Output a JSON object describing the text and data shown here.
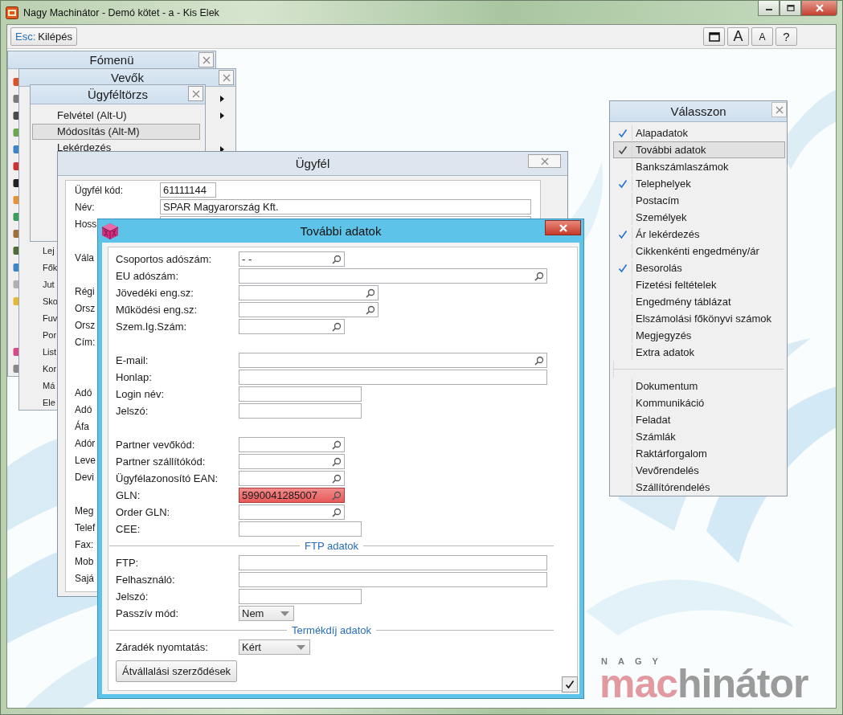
{
  "app": {
    "title": "Nagy Machinátor - Demó kötet - a - Kis Elek"
  },
  "toolbar": {
    "exit": {
      "key": "Esc:",
      "label": "Kilépés"
    },
    "tools": [
      {
        "kind": "window"
      },
      {
        "kind": "font-up",
        "label": "A"
      },
      {
        "kind": "font-down",
        "label": "A"
      },
      {
        "kind": "help",
        "label": "?"
      }
    ]
  },
  "main_menu": {
    "title": "Fómenü"
  },
  "customers_menu": {
    "title": "Vevők",
    "rows": [
      {
        "submenu": true
      },
      {
        "submenu": true
      },
      {
        "submenu": false
      },
      {
        "submenu": true
      }
    ],
    "items": [
      "Lej",
      "Fők",
      "Jut",
      "Sko",
      "Fuv",
      "Por",
      "List",
      "Kor",
      "Má",
      "Ele"
    ]
  },
  "client_menu": {
    "title": "Ügyféltörzs",
    "items": [
      {
        "label": "Felvétel (Alt-U)",
        "selected": false
      },
      {
        "label": "Módosítás (Alt-M)",
        "selected": true
      },
      {
        "label": "Lekérdezés",
        "selected": false
      }
    ]
  },
  "client_window": {
    "title": "Ügyfél",
    "rows": [
      {
        "kind": "short-field",
        "label": "Ügyfél kód:",
        "value": "61111144"
      },
      {
        "kind": "long-field",
        "label": "Név:",
        "value": "SPAR Magyarország Kft."
      },
      {
        "kind": "long-field",
        "label": "Hoss"
      },
      {
        "kind": "gap"
      },
      {
        "kind": "label",
        "label": "Vála"
      },
      {
        "kind": "gap"
      },
      {
        "kind": "label",
        "label": "Régi"
      },
      {
        "kind": "label",
        "label": "Orsz"
      },
      {
        "kind": "label",
        "label": "Orsz"
      },
      {
        "kind": "label",
        "label": "Cím:"
      },
      {
        "kind": "gap"
      },
      {
        "kind": "gap"
      },
      {
        "kind": "label",
        "label": "Adó"
      },
      {
        "kind": "label",
        "label": "Adó"
      },
      {
        "kind": "label",
        "label": "Áfa"
      },
      {
        "kind": "label",
        "label": "Adór"
      },
      {
        "kind": "label",
        "label": "Leve"
      },
      {
        "kind": "label",
        "label": "Devi"
      },
      {
        "kind": "gap"
      },
      {
        "kind": "label",
        "label": "Meg"
      },
      {
        "kind": "label",
        "label": "Telef"
      },
      {
        "kind": "label",
        "label": "Fax:"
      },
      {
        "kind": "label",
        "label": "Mob"
      },
      {
        "kind": "label",
        "label": "Sajá"
      }
    ]
  },
  "dialog": {
    "title": "További adatok",
    "rows": [
      {
        "kind": "tiny-field",
        "label": "Csoportos adószám:",
        "value": "- -",
        "search": true,
        "invalid": false
      },
      {
        "kind": "long-field",
        "label": "EU adószám:",
        "search": true,
        "invalid": false
      },
      {
        "kind": "mid-field",
        "label": "Jövedéki eng.sz:",
        "search": true,
        "invalid": false
      },
      {
        "kind": "mid-field",
        "label": "Működési eng.sz:",
        "search": true,
        "invalid": false
      },
      {
        "kind": "tiny-field",
        "label": "Szem.Ig.Szám:",
        "search": true,
        "invalid": false
      },
      {
        "kind": "gap"
      },
      {
        "kind": "long-field",
        "label": "E-mail:",
        "search": true,
        "invalid": false
      },
      {
        "kind": "long-field",
        "label": "Honlap:",
        "search": false,
        "invalid": false
      },
      {
        "kind": "short-field",
        "label": "Login név:",
        "search": false,
        "invalid": false
      },
      {
        "kind": "short-field",
        "label": "Jelszó:",
        "search": false,
        "invalid": false
      },
      {
        "kind": "gap"
      },
      {
        "kind": "tiny-field",
        "label": "Partner vevőkód:",
        "search": true,
        "invalid": false
      },
      {
        "kind": "tiny-field",
        "label": "Partner szállítókód:",
        "search": true,
        "invalid": false
      },
      {
        "kind": "tiny-field",
        "label": "Ügyfélazonosító EAN:",
        "search": true,
        "invalid": false
      },
      {
        "kind": "tiny-field",
        "label": "GLN:",
        "value": "5990041285007",
        "search": true,
        "invalid": true
      },
      {
        "kind": "tiny-field",
        "label": "Order GLN:",
        "search": true,
        "invalid": false
      },
      {
        "kind": "short-field",
        "label": "CEE:",
        "search": false,
        "invalid": false
      },
      {
        "kind": "separator",
        "label": "FTP adatok"
      },
      {
        "kind": "long-field",
        "label": "FTP:",
        "search": false,
        "invalid": false
      },
      {
        "kind": "long-field",
        "label": "Felhasználó:",
        "search": false,
        "invalid": false
      },
      {
        "kind": "short-field",
        "label": "Jelszó:",
        "search": false,
        "invalid": false
      },
      {
        "kind": "dropdown",
        "label": "Passzív mód:",
        "value": "Nem"
      },
      {
        "kind": "separator",
        "label": "Termékdíj adatok"
      },
      {
        "kind": "wide-dropdown",
        "label": "Záradék nyomtatás:",
        "value": "Kért"
      }
    ],
    "button": "Átvállalási szerződések"
  },
  "choices": {
    "title": "Válasszon",
    "groups": [
      [
        {
          "label": "Alapadatok",
          "checked": true,
          "selected": false
        },
        {
          "label": "További adatok",
          "checked": true,
          "selected": true
        },
        {
          "label": "Bankszámlaszámok",
          "checked": false,
          "selected": false
        },
        {
          "label": "Telephelyek",
          "checked": true,
          "selected": false
        },
        {
          "label": "Postacím",
          "checked": false,
          "selected": false
        },
        {
          "label": "Személyek",
          "checked": false,
          "selected": false
        },
        {
          "label": "Ár lekérdezés",
          "checked": true,
          "selected": false
        },
        {
          "label": "Cikkenkénti engedmény/ár",
          "checked": false,
          "selected": false
        },
        {
          "label": "Besorolás",
          "checked": true,
          "selected": false
        },
        {
          "label": "Fizetési feltételek",
          "checked": false,
          "selected": false
        },
        {
          "label": "Engedmény táblázat",
          "checked": false,
          "selected": false
        },
        {
          "label": "Elszámolási főkönyvi számok",
          "checked": false,
          "selected": false
        },
        {
          "label": "Megjegyzés",
          "checked": false,
          "selected": false
        },
        {
          "label": "Extra adatok",
          "checked": false,
          "selected": false
        }
      ],
      [
        {
          "label": "Dokumentum",
          "checked": false,
          "selected": false
        },
        {
          "label": "Kommunikáció",
          "checked": false,
          "selected": false
        },
        {
          "label": "Feladat",
          "checked": false,
          "selected": false
        },
        {
          "label": "Számlák",
          "checked": false,
          "selected": false
        },
        {
          "label": "Raktárforgalom",
          "checked": false,
          "selected": false
        },
        {
          "label": "Vevőrendelés",
          "checked": false,
          "selected": false
        },
        {
          "label": "Szállítórendelés",
          "checked": false,
          "selected": false
        }
      ]
    ]
  },
  "logo": {
    "small": "NAGY",
    "accent": "mac",
    "rest": "hinátor"
  }
}
